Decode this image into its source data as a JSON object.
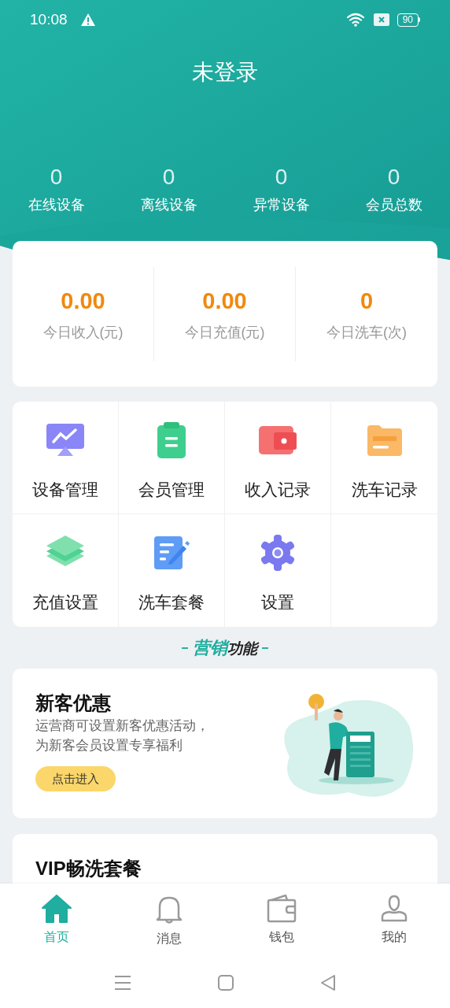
{
  "status_bar": {
    "time": "10:08",
    "battery": "90"
  },
  "title": "未登录",
  "stats": [
    {
      "value": "0",
      "label": "在线设备"
    },
    {
      "value": "0",
      "label": "离线设备"
    },
    {
      "value": "0",
      "label": "异常设备"
    },
    {
      "value": "0",
      "label": "会员总数"
    }
  ],
  "today": [
    {
      "value": "0.00",
      "label": "今日收入(元)"
    },
    {
      "value": "0.00",
      "label": "今日充值(元)"
    },
    {
      "value": "0",
      "label": "今日洗车(次)"
    }
  ],
  "menu": [
    {
      "label": "设备管理"
    },
    {
      "label": "会员管理"
    },
    {
      "label": "收入记录"
    },
    {
      "label": "洗车记录"
    },
    {
      "label": "充值设置"
    },
    {
      "label": "洗车套餐"
    },
    {
      "label": "设置"
    }
  ],
  "section_heading": {
    "highlight": "营销",
    "rest": "功能"
  },
  "promos": [
    {
      "title": "新客优惠",
      "description": [
        "运营商可设置新客优惠活动，",
        "为新客会员设置专享福利"
      ],
      "button": "点击进入"
    },
    {
      "title": "VIP畅洗套餐"
    }
  ],
  "tabs": [
    {
      "label": "首页",
      "selected": true
    },
    {
      "label": "消息",
      "selected": false
    },
    {
      "label": "钱包",
      "selected": false
    },
    {
      "label": "我的",
      "selected": false
    }
  ]
}
